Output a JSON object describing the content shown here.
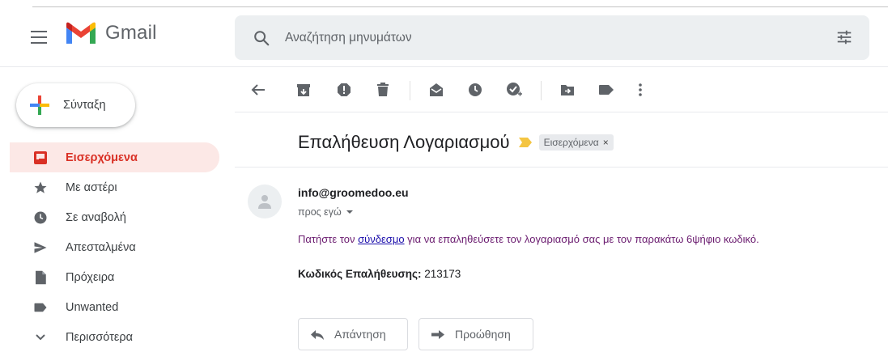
{
  "app": {
    "name": "Gmail"
  },
  "search": {
    "placeholder": "Αναζήτηση μηνυμάτων"
  },
  "compose": {
    "label": "Σύνταξη"
  },
  "sidebar": {
    "items": [
      {
        "label": "Εισερχόμενα",
        "icon": "inbox-icon",
        "active": true
      },
      {
        "label": "Με αστέρι",
        "icon": "star-icon"
      },
      {
        "label": "Σε αναβολή",
        "icon": "clock-icon"
      },
      {
        "label": "Απεσταλμένα",
        "icon": "send-icon"
      },
      {
        "label": "Πρόχειρα",
        "icon": "draft-icon"
      },
      {
        "label": "Unwanted",
        "icon": "label-icon"
      },
      {
        "label": "Περισσότερα",
        "icon": "chevron-down-icon"
      }
    ]
  },
  "toolbar": {
    "icons": [
      "back-arrow-icon",
      "archive-icon",
      "report-spam-icon",
      "delete-icon",
      "mark-unread-icon",
      "snooze-icon",
      "add-to-tasks-icon",
      "move-to-icon",
      "label-icon",
      "more-options-icon"
    ]
  },
  "message": {
    "subject": "Επαλήθευση Λογαριασμού",
    "label_chip": "Εισερχόμενα",
    "chip_close": "×",
    "sender": "info@groomedoo.eu",
    "recipient": "προς εγώ",
    "body_before_link": "Πατήστε τον ",
    "body_link": "σύνδεσμο",
    "body_after_link": " για να επαληθεύσετε τον λογαριασμό σας με τον παρακάτω 6ψήφιο κωδικό.",
    "code_label": "Κωδικός Επαλήθευσης:",
    "code_value": " 213173"
  },
  "actions": {
    "reply_label": "Απάντηση",
    "forward_label": "Προώθηση"
  },
  "colors": {
    "accent": "#d93025",
    "active_bg": "#fce8e6",
    "link": "#1a0dab",
    "body_text": "#6a1b6f",
    "importance": "#f4c542"
  }
}
